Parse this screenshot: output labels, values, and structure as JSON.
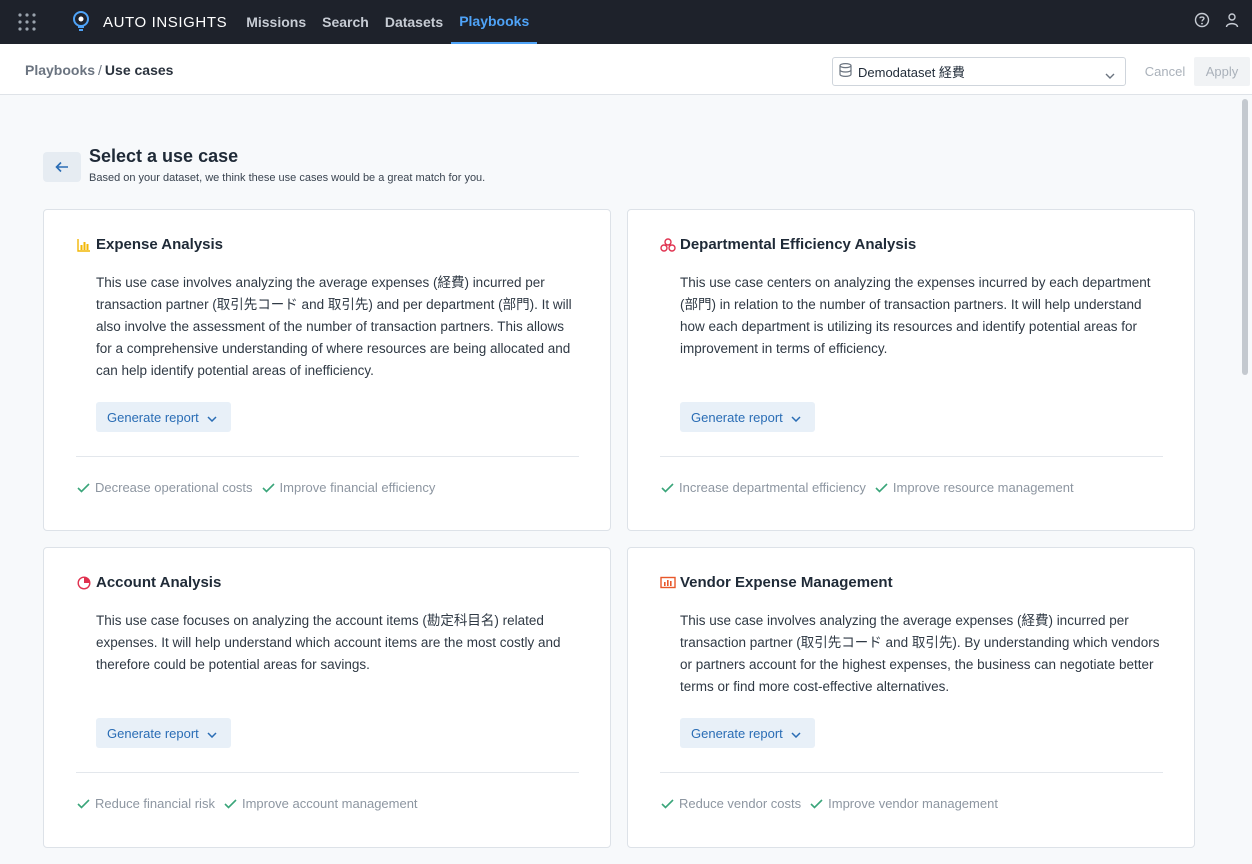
{
  "nav": {
    "brand": "AUTO INSIGHTS",
    "links": [
      "Missions",
      "Search",
      "Datasets",
      "Playbooks"
    ],
    "active": "Playbooks",
    "accent": "#4fa3f7"
  },
  "header": {
    "breadcrumb_parent": "Playbooks",
    "breadcrumb_sep": "/",
    "breadcrumb_current": "Use cases",
    "dataset_value": "Demodataset 経費",
    "cancel_label": "Cancel",
    "apply_label": "Apply"
  },
  "page": {
    "title": "Select a use case",
    "subtitle": "Based on your dataset, we think these use cases would be a great match for you."
  },
  "cards": [
    {
      "icon": "bar-chart-icon",
      "title": "Expense Analysis",
      "description": "This use case involves analyzing the average expenses (経費) incurred per transaction partner (取引先コード and 取引先) and per department (部門). It will also involve the assessment of the number of transaction partners. This allows for a comprehensive understanding of where resources are being allocated and can help identify potential areas of inefficiency.",
      "button": "Generate report",
      "tags": [
        "Decrease operational costs",
        "Improve financial efficiency"
      ]
    },
    {
      "icon": "department-icon",
      "title": "Departmental Efficiency Analysis",
      "description": "This use case centers on analyzing the expenses incurred by each department (部門) in relation to the number of transaction partners. It will help understand how each department is utilizing its resources and identify potential areas for improvement in terms of efficiency.",
      "button": "Generate report",
      "tags": [
        "Increase departmental efficiency",
        "Improve resource management"
      ]
    },
    {
      "icon": "pie-chart-icon",
      "title": "Account Analysis",
      "description": "This use case focuses on analyzing the account items (勘定科目名) related expenses. It will help understand which account items are the most costly and therefore could be potential areas for savings.",
      "button": "Generate report",
      "tags": [
        "Reduce financial risk",
        "Improve account management"
      ]
    },
    {
      "icon": "presentation-chart-icon",
      "title": "Vendor Expense Management",
      "description": "This use case involves analyzing the average expenses (経費) incurred per transaction partner (取引先コード and 取引先). By understanding which vendors or partners account for the highest expenses, the business can negotiate better terms or find more cost-effective alternatives.",
      "button": "Generate report",
      "tags": [
        "Reduce vendor costs",
        "Improve vendor management"
      ]
    }
  ]
}
